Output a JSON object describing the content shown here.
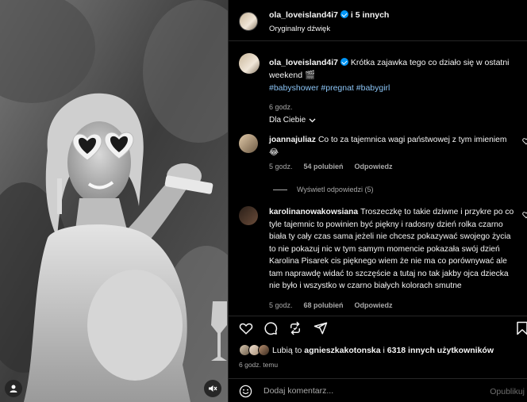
{
  "header": {
    "username": "ola_loveisland4i7",
    "collab": "i 5 innych",
    "audio": "Oryginalny dźwięk"
  },
  "caption": {
    "username": "ola_loveisland4i7",
    "text": "Krótka zajawka tego co działo się w ostatni weekend",
    "emoji": "🎬",
    "hashtags": [
      "#babyshower",
      "#pregnat",
      "#babygirl"
    ],
    "time": "6 godz."
  },
  "sort_label": "Dla Ciebie",
  "comments": [
    {
      "username": "joannajuliaz",
      "text": "Co to za tajemnica wagi państwowej z tym imieniem 😂",
      "time": "5 godz.",
      "likes": "54 polubień",
      "reply": "Odpowiedz"
    },
    {
      "username": "karolinanowakowsiana",
      "text": "Troszeczkę to takie dziwne i przykre po co tyle tajemnic to powinien być piękny i radosny dzień rolka czarno biała ty cały czas sama jeżeli nie chcesz pokazywać swojego życia to nie pokazuj nic w tym samym momencie pokazała swój dzień Karolina Pisarek cis pięknego wiem że nie ma co porównywać ale tam naprawdę widać to szczęście a tutaj no tak jakby ojca dziecka nie było i wszystko w czarno białych kolorach smutne",
      "time": "5 godz.",
      "likes": "68 polubień",
      "reply": "Odpowiedz"
    }
  ],
  "view_replies": "Wyświetl odpowiedzi (5)",
  "likes_line": {
    "prefix": "Lubią to",
    "user": "agnieszkakotonska",
    "middle": "i",
    "count": "6318 innych użytkowników"
  },
  "posted": "6 godz. temu",
  "add_comment": {
    "placeholder": "Dodaj komentarz...",
    "publish": "Opublikuj"
  },
  "icons": [
    "user-tag-icon",
    "mute-icon",
    "verified-icon",
    "chevron-down-icon",
    "heart-icon",
    "comment-icon",
    "repost-icon",
    "share-icon",
    "bookmark-icon",
    "emoji-icon"
  ],
  "colors": {
    "verified": "#0095f6",
    "hashtag": "#8bc4f5",
    "muted": "#a8a8a8",
    "border": "#262626"
  }
}
